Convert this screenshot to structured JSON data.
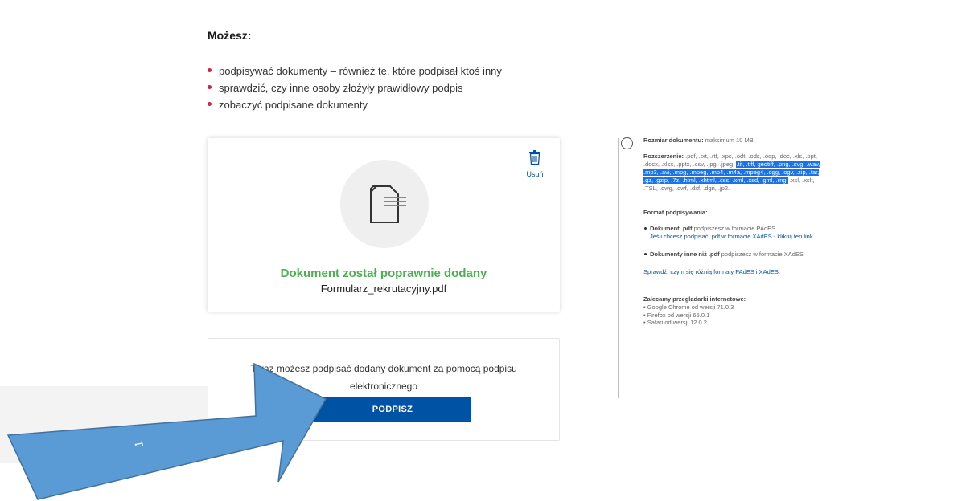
{
  "intro": {
    "heading": "Możesz:",
    "items": [
      "podpisywać dokumenty – również te, które podpisał ktoś inny",
      "sprawdzić, czy inne osoby złożyły prawidłowy podpis",
      "zobaczyć podpisane dokumenty"
    ]
  },
  "document": {
    "delete_label": "Usuń",
    "success_text": "Dokument został poprawnie dodany",
    "filename": "Formularz_rekrutacyjny.pdf"
  },
  "sign": {
    "description_line1": "Teraz możesz podpisać dodany dokument za pomocą podpisu",
    "description_line2": "elektronicznego",
    "button_label": "PODPISZ"
  },
  "info": {
    "size_label": "Rozmiar dokumentu:",
    "size_value": "maksimum 10 MB.",
    "ext_label": "Rozszerzenie:",
    "ext_plain": ".pdf, .txt, .rtf, .xps, .odt, .ods, .odp, .doc, .xls, .ppt, .docx, .xlsx, .pptx, .csv, .jpg, .jpeg,",
    "ext_highlighted": ".tif, .tiff, geotiff, .png, .svg, .wav, .mp3, .avi, .mpg, .mpeg, .mp4, .m4a, .mpeg4, .ogg, .ogv, .zip, .tar, .gz, .gzip, .7z, .html, .xhtml, .css, .xml, .xsd, .gml, .rng,",
    "ext_rest": ".xsl, .xslt, .TSL, .dwg, .dwf, .dxf, .dgn, .jp2.",
    "format_title": "Format podpisywania:",
    "pdf_bold": "Dokument .pdf",
    "pdf_text": "podpiszesz w formacie PAdES",
    "pdf_link": "Jeśli chcesz podpisać .pdf w formacie XAdES - kliknij ten link.",
    "other_bold": "Dokumenty inne niż .pdf",
    "other_text": "podpiszesz w formacie XAdES",
    "diff_link": "Sprawdź, czym się różnią formaty PAdES i XAdES.",
    "browsers_title": "Zalecamy przeglądarki internetowe:",
    "browsers": [
      "• Google Chrome od wersji 71.0.3",
      "• Firefox od wersji 65.0.1",
      "• Safari od wersji 12.0.2"
    ]
  },
  "annotation": {
    "arrow_label": "1",
    "arrow_color": "#5b9bd5"
  },
  "colors": {
    "accent_red": "#d4213d",
    "primary_blue": "#0052a5",
    "success_green": "#4caf50"
  }
}
